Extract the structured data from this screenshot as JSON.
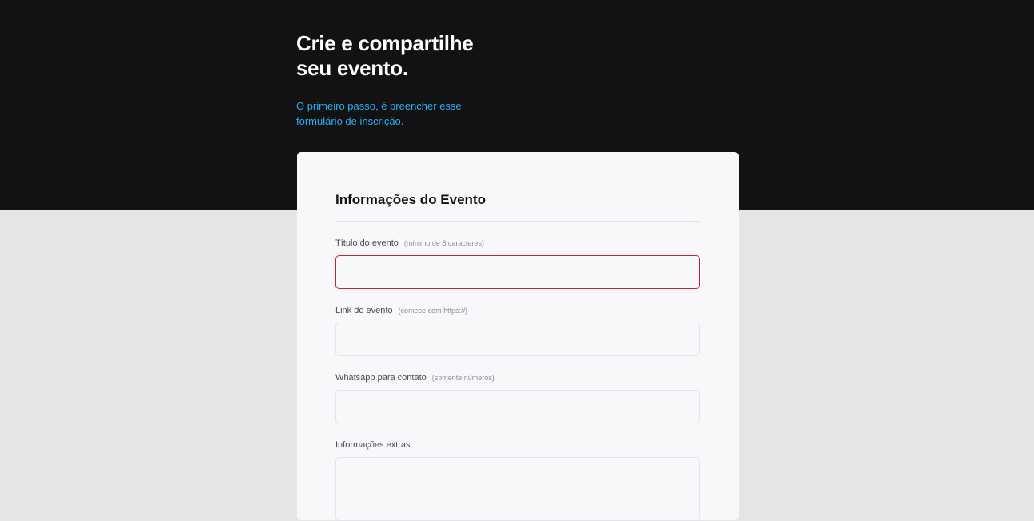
{
  "hero": {
    "title_line1": "Crie e compartilhe",
    "title_line2": "seu evento.",
    "subtitle_line1": "O primeiro passo, é preencher esse",
    "subtitle_line2": "formulário de inscrição."
  },
  "form": {
    "title": "Informações do Evento",
    "fields": [
      {
        "label": "Título do evento",
        "hint": "(mínimo de 8 caracteres)",
        "value": "",
        "placeholder": "",
        "state": "error"
      },
      {
        "label": "Link do evento",
        "hint": "(comece com https://)",
        "value": "",
        "placeholder": ""
      },
      {
        "label": "Whatsapp para contato",
        "hint": "(somente números)",
        "value": "",
        "placeholder": ""
      },
      {
        "label": "Informações extras",
        "hint": "",
        "value": "",
        "placeholder": ""
      }
    ]
  },
  "colors": {
    "hero_bg": "#121214",
    "page_bg": "#e5e5e5",
    "card_bg": "#f8f8fa",
    "accent": "#2ab0e8",
    "error": "#cc1f2f"
  }
}
